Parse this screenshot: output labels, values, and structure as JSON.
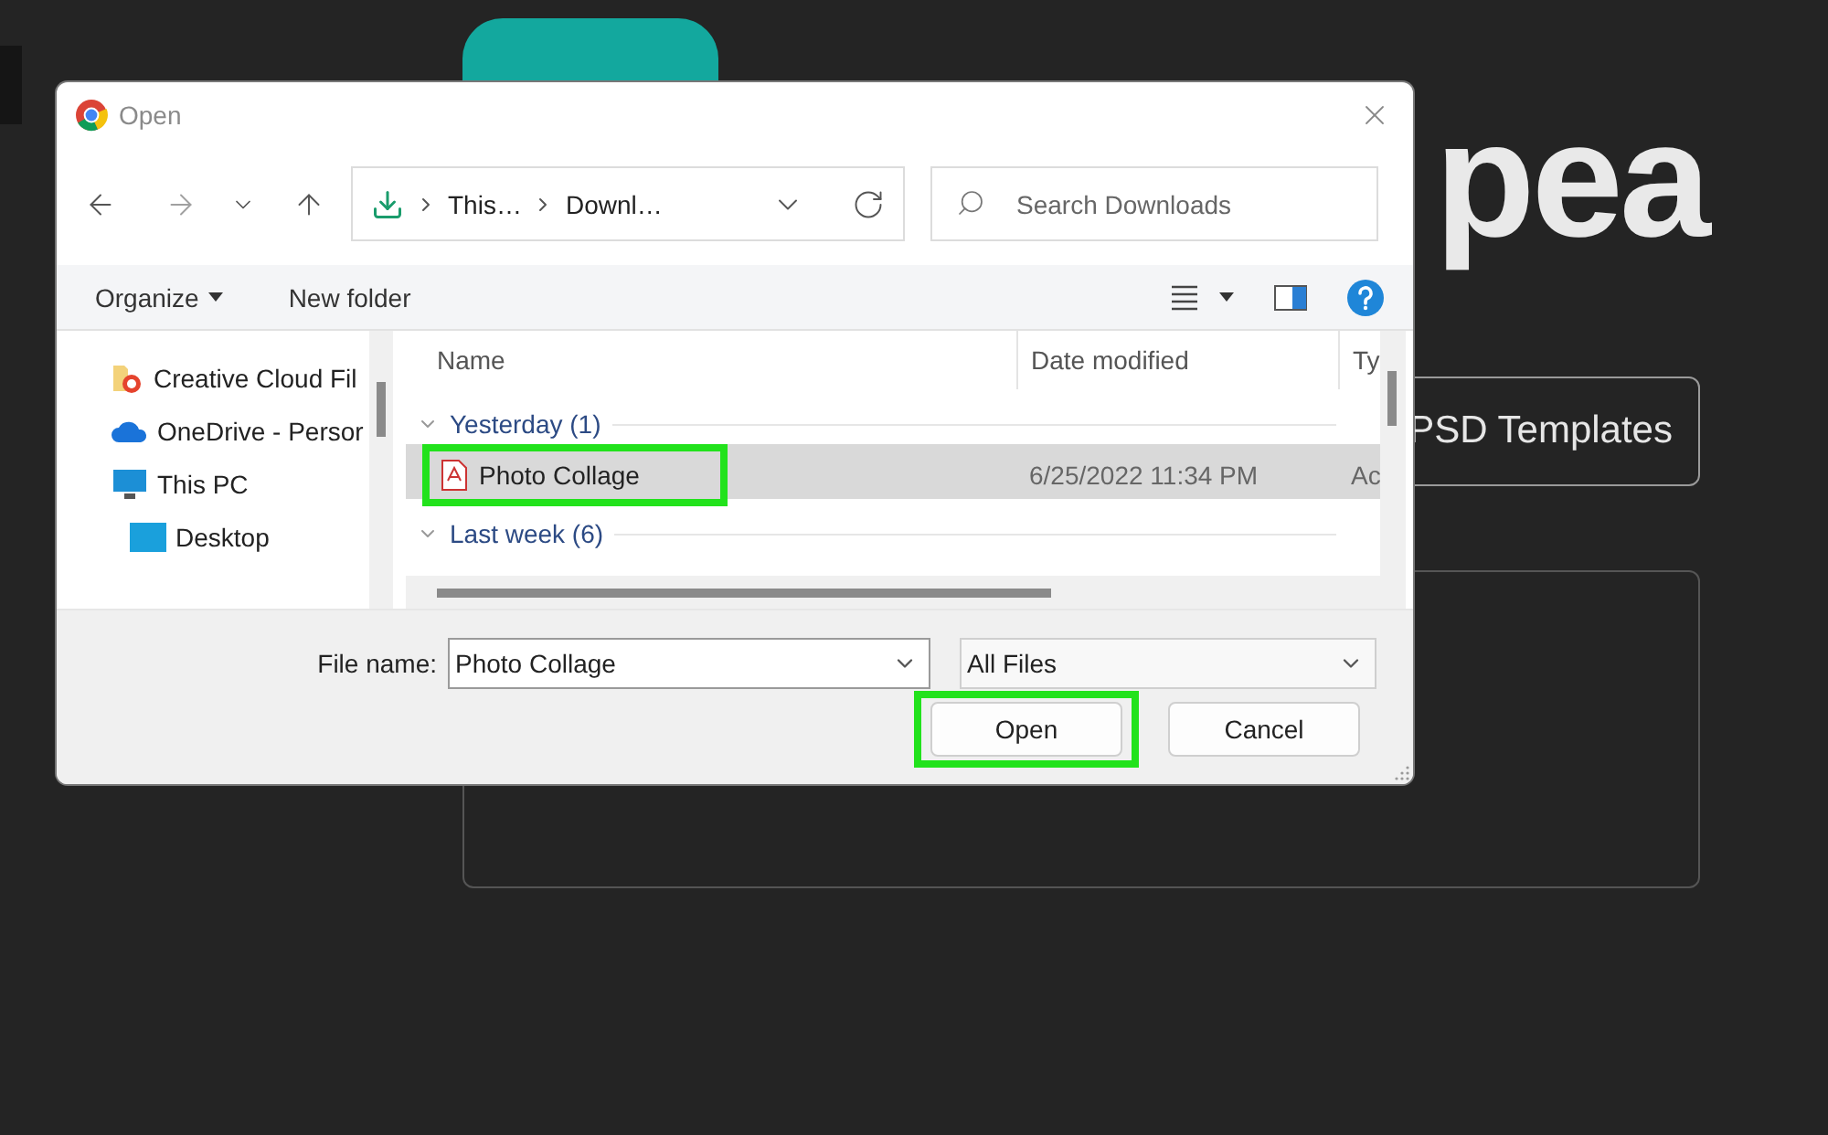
{
  "background": {
    "logo_text": "pea",
    "button": "PSD Templates"
  },
  "dialog": {
    "title": "Open",
    "breadcrumb": [
      "This…",
      "Downl…"
    ],
    "search": {
      "placeholder": "Search Downloads"
    },
    "toolbar": {
      "organize": "Organize",
      "new_folder": "New folder"
    },
    "sidebar": [
      {
        "label": "Creative Cloud Fil",
        "kind": "creative-cloud"
      },
      {
        "label": "OneDrive - Persor",
        "kind": "onedrive"
      },
      {
        "label": "This PC",
        "kind": "pc",
        "children": [
          {
            "label": "Desktop",
            "kind": "desktop"
          }
        ]
      }
    ],
    "columns": [
      "Name",
      "Date modified",
      "Ty"
    ],
    "groups": [
      {
        "label": "Yesterday (1)",
        "expanded": true,
        "files": [
          {
            "name": "Photo Collage",
            "date": "6/25/2022 11:34 PM",
            "column_3": "Ac",
            "selected": true,
            "highlighted": true
          }
        ]
      },
      {
        "label": "Last week (6)",
        "expanded": true
      }
    ],
    "file_name": {
      "label": "File name:",
      "value": "Photo Collage"
    },
    "file_type": "All Files",
    "buttons": [
      {
        "label": "Open",
        "highlighted": true
      },
      {
        "label": "Cancel",
        "highlighted": false
      }
    ]
  }
}
